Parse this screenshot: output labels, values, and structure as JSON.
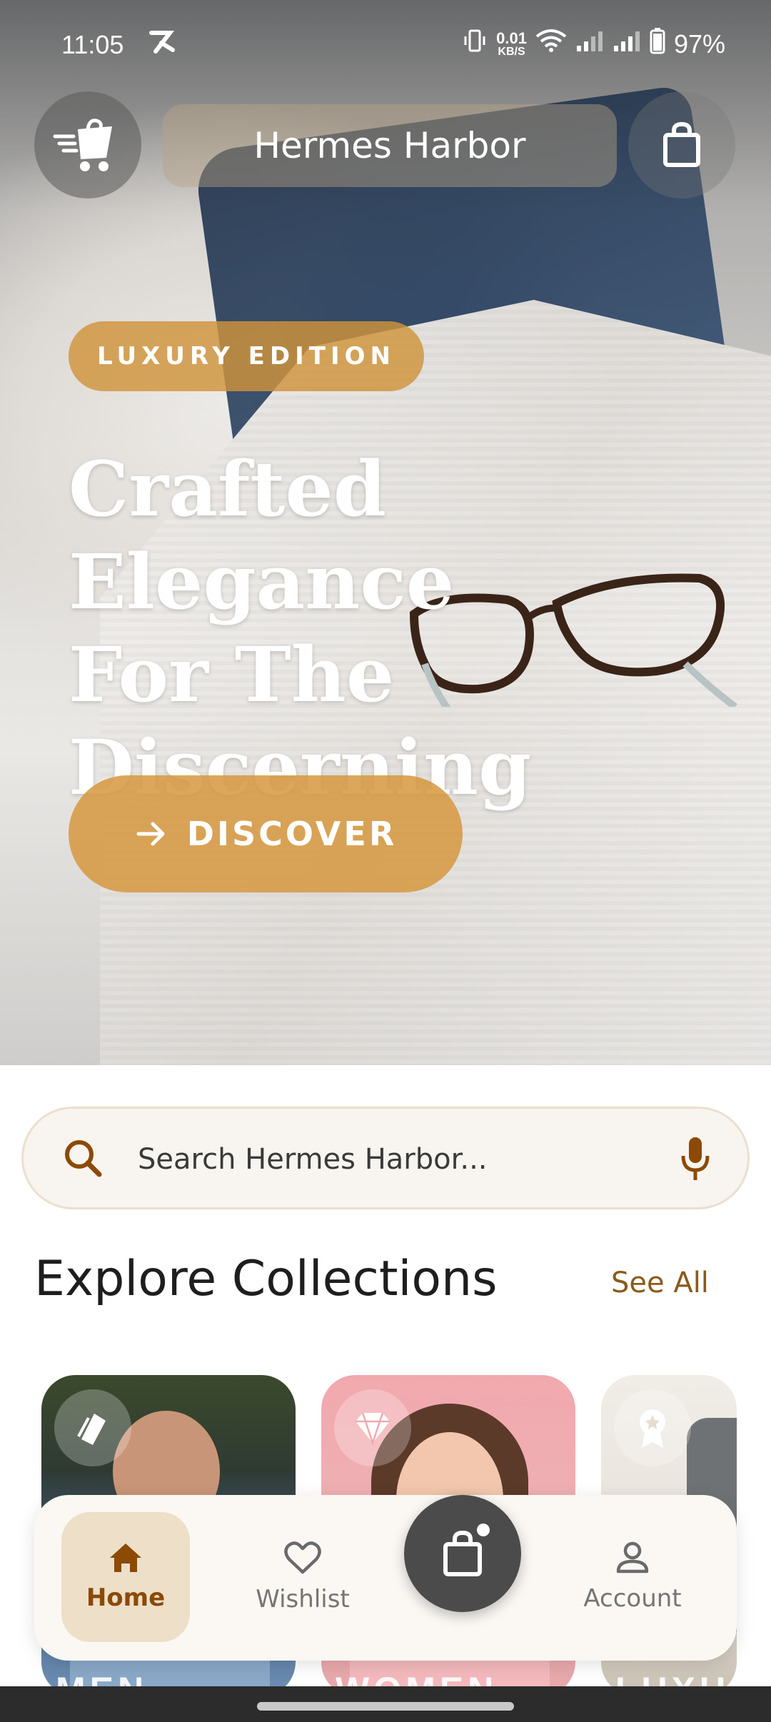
{
  "status_bar": {
    "time": "11:05",
    "data_speed_value": "0.01",
    "data_speed_unit": "KB/S",
    "battery": "97%"
  },
  "top_bar": {
    "title": "Hermes Harbor"
  },
  "hero": {
    "badge": "LUXURY EDITION",
    "headline_line1": "Crafted Elegance",
    "headline_line2": "For The",
    "headline_line3": "Discerning",
    "cta_label": "DISCOVER"
  },
  "search": {
    "placeholder": "Search Hermes Harbor..."
  },
  "collections": {
    "title": "Explore Collections",
    "see_all": "See All",
    "cards": [
      {
        "label": "MEN"
      },
      {
        "label": "WOMEN"
      },
      {
        "label": "LUXU"
      }
    ]
  },
  "bottom_nav": {
    "items": [
      {
        "label": "Home",
        "active": true
      },
      {
        "label": "Wishlist",
        "active": false
      },
      {
        "label": "Account",
        "active": false
      }
    ]
  },
  "colors": {
    "accent": "#d0943c",
    "accent_dark": "#8b4a06",
    "nav_active_bg": "#eedfc8"
  },
  "icons": [
    "menu-cart-icon",
    "shopping-bag-icon",
    "arrow-right-icon",
    "search-icon",
    "mic-icon",
    "home-icon",
    "heart-icon",
    "person-icon",
    "diamond-icon",
    "award-icon",
    "tag-icon"
  ]
}
